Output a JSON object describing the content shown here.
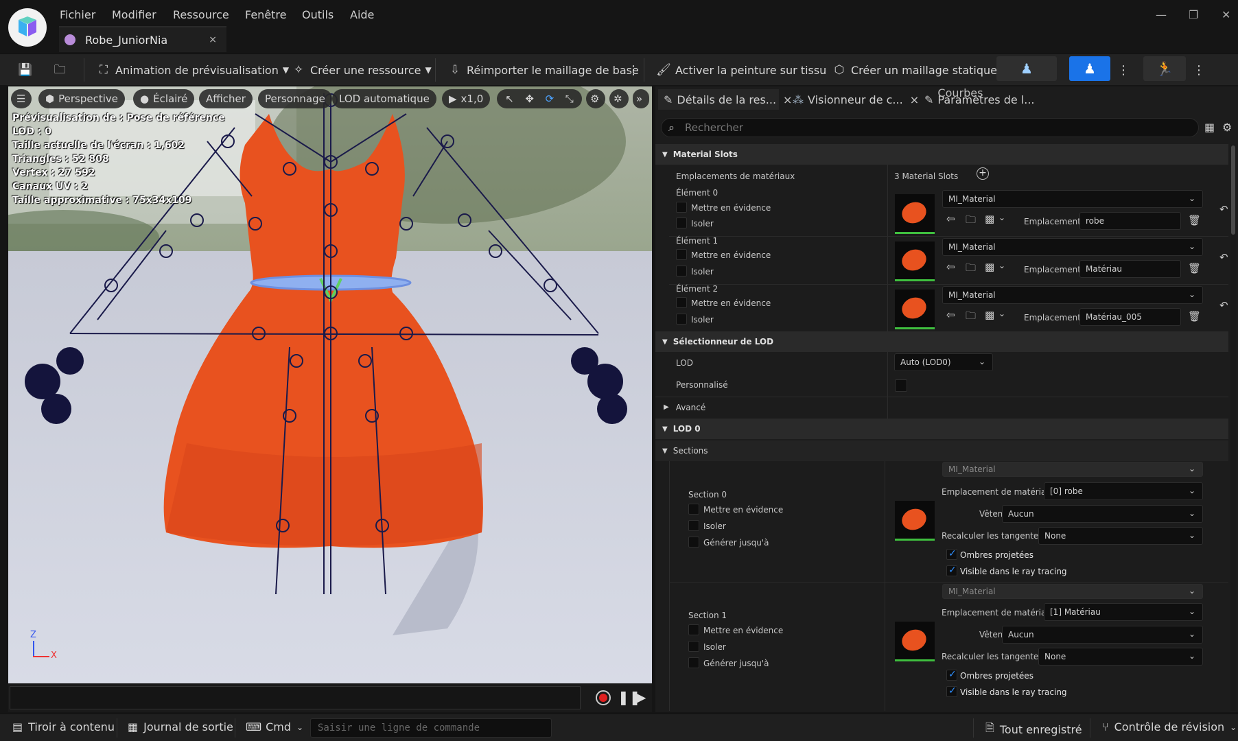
{
  "menu": [
    "Fichier",
    "Modifier",
    "Ressource",
    "Fenêtre",
    "Outils",
    "Aide"
  ],
  "document_tab": {
    "title": "Robe_JuniorNia",
    "close": "×"
  },
  "window_controls": {
    "minimize": "—",
    "restore": "❐",
    "close": "✕"
  },
  "toolbar": {
    "preview_animation": "Animation de prévisualisation",
    "create_asset": "Créer une ressource",
    "reimport": "Réimporter le maillage de base",
    "cloth_paint": "Activer la peinture sur tissu",
    "static_mesh": "Créer un maillage statique"
  },
  "viewport": {
    "perspective": "Perspective",
    "lit": "Éclairé",
    "show": "Afficher",
    "character": "Personnage",
    "lod": "LOD automatique",
    "speed": "x1,0",
    "info": [
      "Prévisualisation de : Pose de référence",
      "LOD : 0",
      "Taille actuelle de l'écran : 1,602",
      "Triangles : 52 808",
      "Vertex : 27 592",
      "Canaux UV : 2",
      "Taille approximative : 75x34x109"
    ],
    "axis_z": "Z",
    "axis_x": "X"
  },
  "panel": {
    "tabs": [
      {
        "label": "Détails de la res...",
        "close": "×"
      },
      {
        "label": "Visionneur de c...",
        "close": "×"
      },
      {
        "label": "Paramètres de l..."
      }
    ],
    "tab_overlay": "Courbes",
    "search_placeholder": "Rechercher",
    "material_slots": {
      "header": "Material Slots",
      "label": "Emplacements de matériaux",
      "count": "3 Material Slots",
      "elements": [
        {
          "name": "Élément 0",
          "highlight": "Mettre en évidence",
          "isolate": "Isoler",
          "material": "MI_Material",
          "slot_label": "Emplacement",
          "slot_value": "robe"
        },
        {
          "name": "Élément 1",
          "highlight": "Mettre en évidence",
          "isolate": "Isoler",
          "material": "MI_Material",
          "slot_label": "Emplacement",
          "slot_value": "Matériau"
        },
        {
          "name": "Élément 2",
          "highlight": "Mettre en évidence",
          "isolate": "Isoler",
          "material": "MI_Material",
          "slot_label": "Emplacement",
          "slot_value": "Matériau_005"
        }
      ]
    },
    "lod_picker": {
      "header": "Sélectionneur de LOD",
      "lod_label": "LOD",
      "lod_value": "Auto (LOD0)",
      "custom_label": "Personnalisé"
    },
    "advanced": "Avancé",
    "lod0": "LOD 0",
    "sections_header": "Sections",
    "sections": [
      {
        "name": "Section 0",
        "highlight": "Mettre en évidence",
        "isolate": "Isoler",
        "generate": "Générer jusqu'à",
        "material": "MI_Material",
        "slot_label": "Emplacement de matériau",
        "slot_value": "[0] robe",
        "clothing_label": "Vêtements",
        "clothing_value": "Aucun",
        "tangents_label": "Recalculer les tangentes",
        "tangents_value": "None",
        "shadows": "Ombres projetées",
        "raytracing": "Visible dans le ray tracing"
      },
      {
        "name": "Section 1",
        "highlight": "Mettre en évidence",
        "isolate": "Isoler",
        "generate": "Générer jusqu'à",
        "material": "MI_Material",
        "slot_label": "Emplacement de matériau",
        "slot_value": "[1] Matériau",
        "clothing_label": "Vêtements",
        "clothing_value": "Aucun",
        "tangents_label": "Recalculer les tangentes",
        "tangents_value": "None",
        "shadows": "Ombres projetées",
        "raytracing": "Visible dans le ray tracing"
      }
    ]
  },
  "statusbar": {
    "content_drawer": "Tiroir à contenu",
    "output_log": "Journal de sortie",
    "cmd": "Cmd",
    "cmd_placeholder": "Saisir une ligne de commande",
    "save_all": "Tout enregistré",
    "revision": "Contrôle de révision"
  },
  "colors": {
    "accent": "#1a73e8",
    "dress": "#e8521f",
    "check": "#2e8fff"
  }
}
